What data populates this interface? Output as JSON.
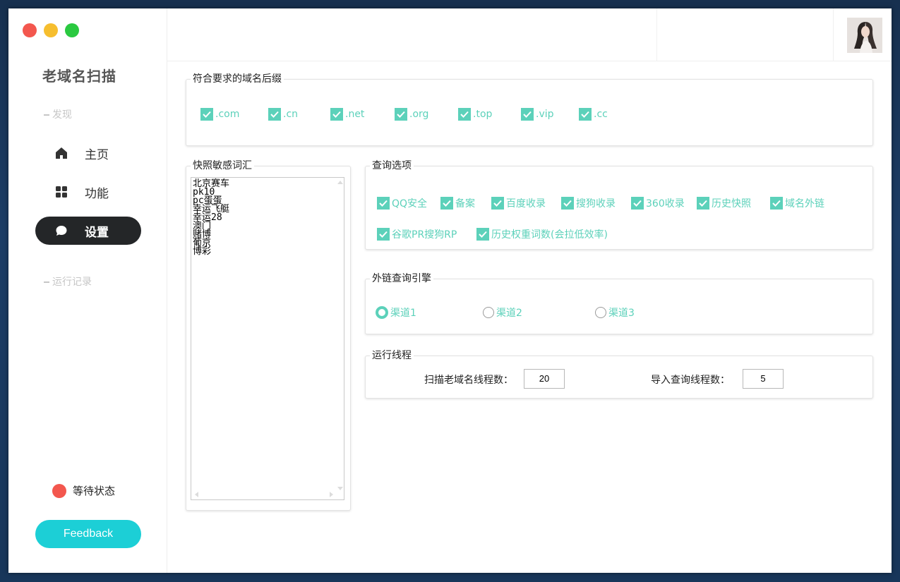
{
  "sidebar": {
    "app_title": "老域名扫描",
    "section_discover": "发现",
    "section_log": "运行记录",
    "nav": [
      {
        "label": "主页",
        "icon": "home-icon"
      },
      {
        "label": "功能",
        "icon": "grid-icon"
      },
      {
        "label": "设置",
        "icon": "chat-bubble-icon",
        "active": true
      }
    ],
    "status_text": "等待状态",
    "status_color": "#f3574e",
    "feedback_label": "Feedback"
  },
  "suffix_group": {
    "title": "符合要求的域名后缀",
    "items": [
      ".com",
      ".cn",
      ".net",
      ".org",
      ".top",
      ".vip",
      ".cc"
    ]
  },
  "sensitive_group": {
    "title": "快照敏感词汇",
    "words": "北京赛车\npk10\npc蛋蛋\n幸运飞艇\n幸运28\n澳门\n赌博\n葡京\n博彩"
  },
  "query_group": {
    "title": "查询选项",
    "row1": [
      "QQ安全",
      "备案",
      "百度收录",
      "搜狗收录",
      "360收录",
      "历史快照",
      "域名外链"
    ],
    "row2": [
      "谷歌PR搜狗RP",
      "历史权重词数(会拉低效率)"
    ]
  },
  "engine_group": {
    "title": "外链查询引擎",
    "options": [
      "渠道1",
      "渠道2",
      "渠道3"
    ],
    "selected": "渠道1"
  },
  "thread_group": {
    "title": "运行线程",
    "scan_label": "扫描老域名线程数：",
    "scan_value": "20",
    "import_label": "导入查询线程数：",
    "import_value": "5"
  },
  "colors": {
    "accent": "#5cd1ba",
    "feedback": "#1ccfd6",
    "active_nav": "#242628"
  }
}
